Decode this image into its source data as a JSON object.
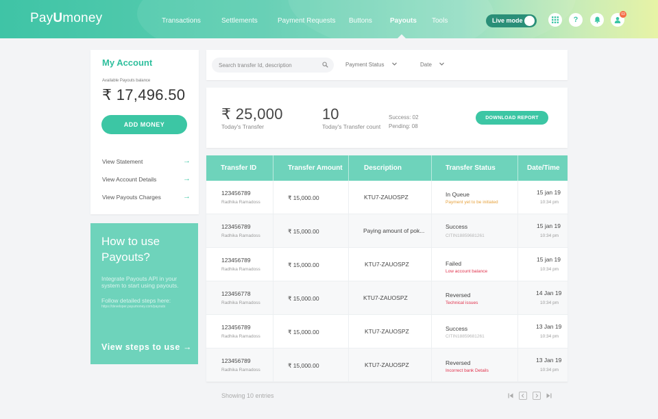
{
  "brand": {
    "logo_prefix": "Pay",
    "logo_u": "U",
    "logo_suffix": "money"
  },
  "nav": [
    {
      "label": "Transactions"
    },
    {
      "label": "Settlements"
    },
    {
      "label": "Payment Requests"
    },
    {
      "label": "Buttons"
    },
    {
      "label": "Payouts",
      "active": true
    },
    {
      "label": "Tools"
    }
  ],
  "header": {
    "mode_label": "Live mode",
    "notification_count": "03",
    "icons": [
      "grid-icon",
      "help-icon",
      "notification-icon",
      "user-icon"
    ]
  },
  "account": {
    "title": "My Account",
    "balance_label": "Available Payouts balance",
    "balance": "₹ 17,496.50",
    "add_money": "ADD MONEY",
    "links": [
      "View Statement",
      "View Account Details",
      "View Payouts Charges"
    ]
  },
  "howto": {
    "title": "How to use Payouts?",
    "text1": "Integrate Payouts API in your system to start using payouts.",
    "text2": "Follow detailed steps here:",
    "url": "https://developer.payumoney.com/payouts",
    "cta": "View steps to use →"
  },
  "filters": {
    "search_placeholder": "Search transfer Id, description",
    "payment_status": "Payment Status",
    "date": "Date"
  },
  "summary": {
    "todays_transfer": "₹ 25,000",
    "todays_transfer_label": "Today's Transfer",
    "todays_count": "10",
    "todays_count_label": "Today's Transfer count",
    "success": "Success: 02",
    "pending": "Pending: 08",
    "download": "DOWNLOAD REPORT"
  },
  "table": {
    "headers": [
      "Transfer ID",
      "Transfer Amount",
      "Description",
      "Transfer Status",
      "Date/Time"
    ],
    "rows": [
      {
        "id": "123456789",
        "name": "Radhika Ramadoss",
        "amount": "₹ 15,000.00",
        "description": "KTU7-ZAUOSPZ",
        "status": "In Queue",
        "sub": "Payment yet to be initiated",
        "sub_type": "amber",
        "date": "15 jan 19",
        "time": "10:34 pm"
      },
      {
        "id": "123456789",
        "name": "Radhika Ramadoss",
        "amount": "₹ 15,000.00",
        "description": "Paying amount of pok...",
        "status": "Success",
        "sub": "CITIN18859681261",
        "sub_type": "grey",
        "date": "15 jan 19",
        "time": "10:34 pm"
      },
      {
        "id": "123456789",
        "name": "Radhika Ramadoss",
        "amount": "₹ 15,000.00",
        "description": "KTU7-ZAUOSPZ",
        "status": "Failed",
        "sub": "Low account balance",
        "sub_type": "red",
        "date": "15 jan 19",
        "time": "10:34 pm"
      },
      {
        "id": "123456778",
        "name": "Radhika Ramadoss",
        "amount": "₹ 15,000.00",
        "description": "KTU7-ZAUOSPZ",
        "status": "Reversed",
        "sub": "Technical issues",
        "sub_type": "red",
        "date": "14 Jan 19",
        "time": "10:34 pm"
      },
      {
        "id": "123456789",
        "name": "Radhika Ramadoss",
        "amount": "₹ 15,000.00",
        "description": "KTU7-ZAUOSPZ",
        "status": "Success",
        "sub": "CITIN18859681261",
        "sub_type": "grey",
        "date": "13 Jan 19",
        "time": "10:34 pm"
      },
      {
        "id": "123456789",
        "name": "Radhika Ramadoss",
        "amount": "₹ 15,000.00",
        "description": "KTU7-ZAUOSPZ",
        "status": "Reversed",
        "sub": "Incorrect bank Details",
        "sub_type": "red",
        "date": "13 Jan 19",
        "time": "10:34 pm"
      }
    ]
  },
  "footer": {
    "showing": "Showing 10 entries",
    "pager": [
      "first-page-icon",
      "prev-page-icon",
      "next-page-icon",
      "last-page-icon"
    ]
  },
  "colors": {
    "accent": "#3cc6a4",
    "header_teal": "#6ed3bb",
    "danger": "#e0314b",
    "warning": "#e6a13b"
  }
}
